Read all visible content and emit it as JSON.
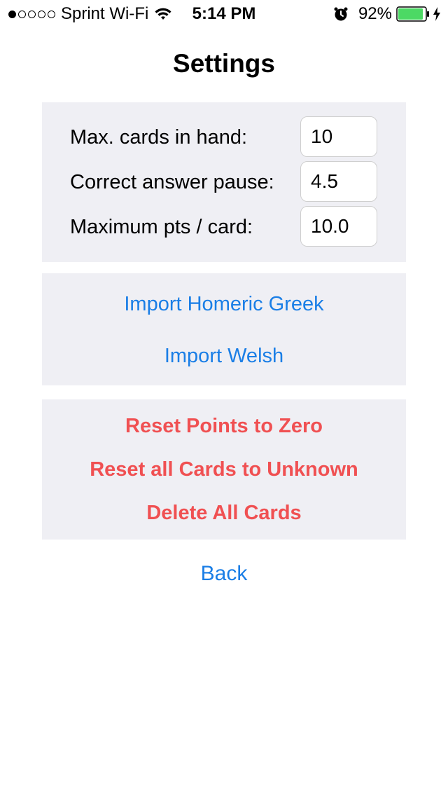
{
  "status_bar": {
    "carrier": "Sprint Wi-Fi",
    "time": "5:14 PM",
    "battery_percent": "92%",
    "signal_strength_filled": 1,
    "signal_strength_total": 5,
    "battery_level": 0.92,
    "battery_color": "#4cd964",
    "icons": [
      "wifi-icon",
      "alarm-icon",
      "battery-icon",
      "charging-bolt-icon"
    ]
  },
  "page": {
    "title": "Settings"
  },
  "settings": {
    "rows": [
      {
        "label": "Max. cards in hand:",
        "value": "10"
      },
      {
        "label": "Correct answer pause:",
        "value": "4.5"
      },
      {
        "label": "Maximum pts / card:",
        "value": "10.0"
      }
    ]
  },
  "imports": {
    "homeric_greek": "Import Homeric Greek",
    "welsh": "Import Welsh"
  },
  "reset": {
    "reset_points": "Reset Points to Zero",
    "reset_cards": "Reset all Cards to Unknown",
    "delete_cards": "Delete All Cards"
  },
  "nav": {
    "back": "Back"
  },
  "colors": {
    "link_blue": "#1a7ee6",
    "destructive_red": "#f05052",
    "section_background": "#efeff4"
  }
}
